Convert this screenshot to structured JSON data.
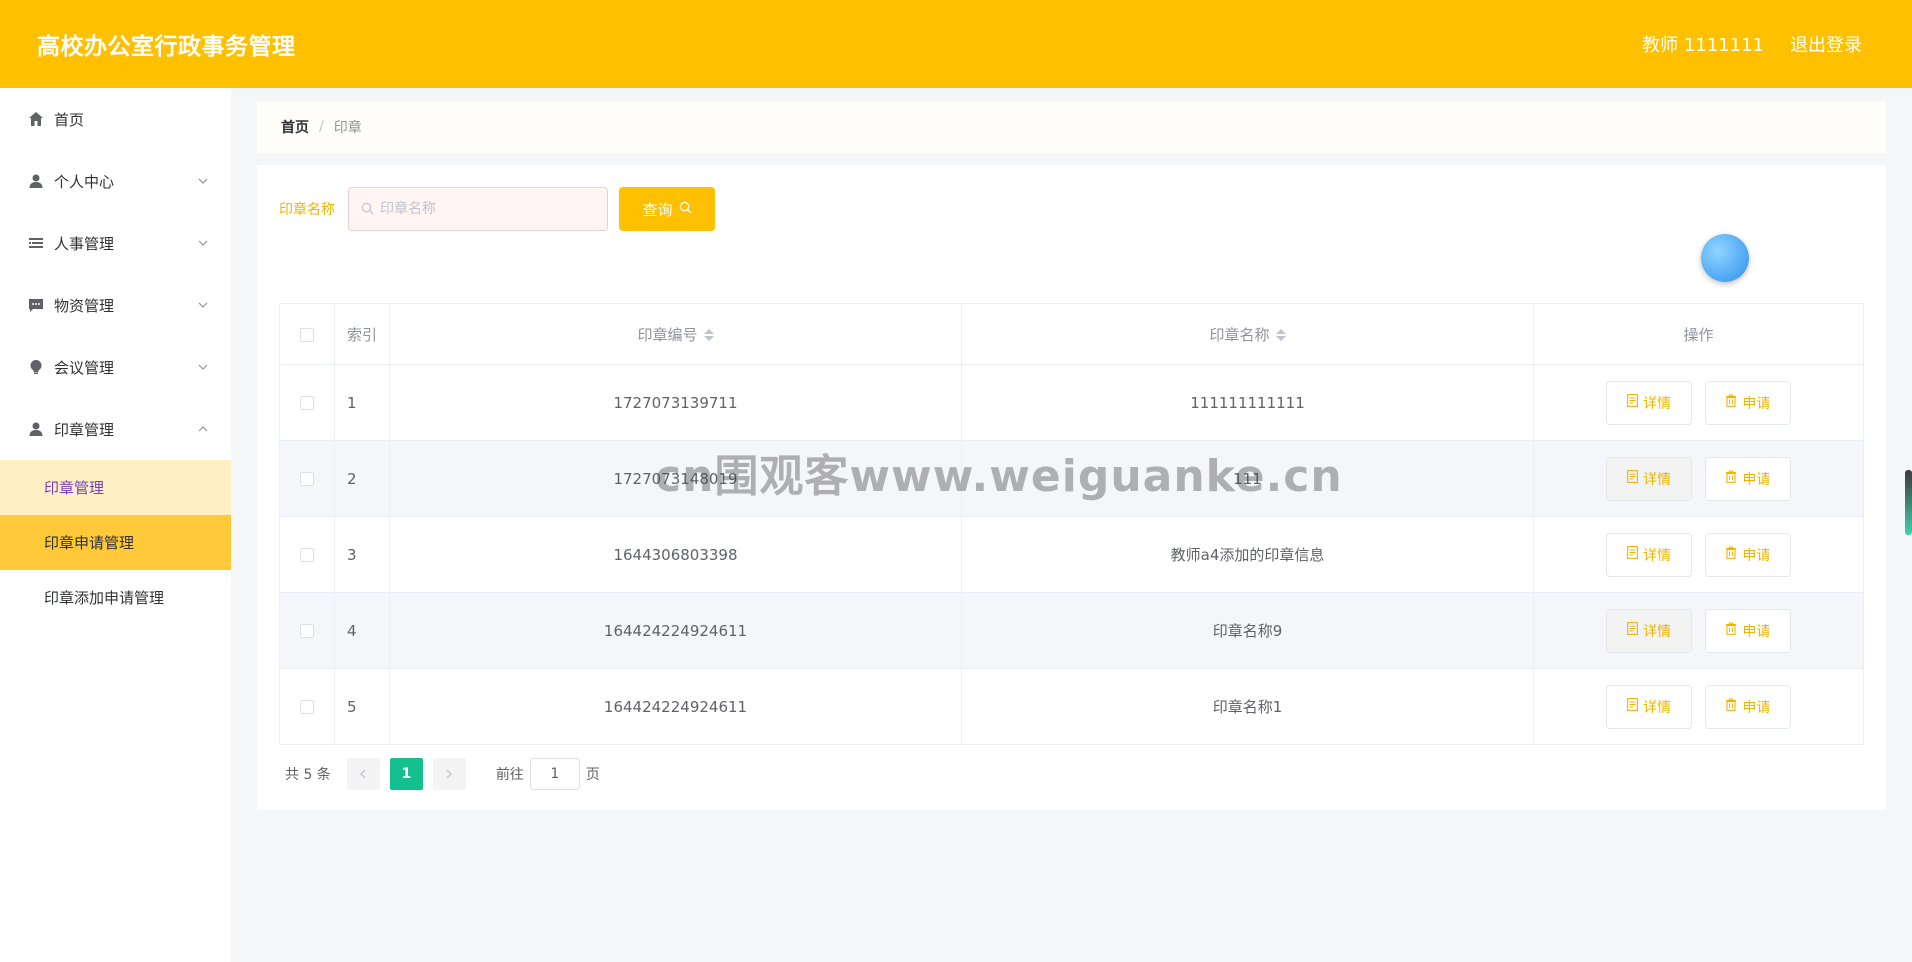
{
  "header": {
    "app_title": "高校办公室行政事务管理",
    "user_label": "教师 1111111",
    "logout_label": "退出登录"
  },
  "sidebar": {
    "items": [
      {
        "label": "首页",
        "icon": "home-icon"
      },
      {
        "label": "个人中心",
        "icon": "user-icon"
      },
      {
        "label": "人事管理",
        "icon": "list-icon"
      },
      {
        "label": "物资管理",
        "icon": "chat-icon"
      },
      {
        "label": "会议管理",
        "icon": "bulb-icon"
      },
      {
        "label": "印章管理",
        "icon": "user-icon"
      }
    ],
    "subitems": [
      {
        "label": "印章管理"
      },
      {
        "label": "印章申请管理"
      },
      {
        "label": "印章添加申请管理"
      }
    ]
  },
  "breadcrumb": {
    "home": "首页",
    "separator": "/",
    "current": "印章"
  },
  "search": {
    "label": "印章名称",
    "placeholder": "印章名称",
    "button_label": "查询"
  },
  "table": {
    "headers": {
      "index": "索引",
      "seal_number": "印章编号",
      "seal_name": "印章名称",
      "operations": "操作"
    },
    "rows": [
      {
        "index": "1",
        "seal_number": "1727073139711",
        "seal_name": "111111111111"
      },
      {
        "index": "2",
        "seal_number": "1727073148019",
        "seal_name": "111"
      },
      {
        "index": "3",
        "seal_number": "1644306803398",
        "seal_name": "教师a4添加的印章信息"
      },
      {
        "index": "4",
        "seal_number": "164424224924611",
        "seal_name": "印章名称9"
      },
      {
        "index": "5",
        "seal_number": "164424224924611",
        "seal_name": "印章名称1"
      }
    ],
    "detail_label": "详情",
    "apply_label": "申请"
  },
  "pagination": {
    "total_label": "共 5 条",
    "current_page": "1",
    "goto_label": "前往",
    "goto_value": "1",
    "goto_suffix": "页"
  },
  "watermark": "cn围观客www.weiguanke.cn",
  "colors": {
    "brand": "#ffc000",
    "accent_text": "#f0b400",
    "page_active": "#13c08e",
    "submenu_active_light": "#fff0c4",
    "submenu_active_strong": "#ffc93a"
  }
}
